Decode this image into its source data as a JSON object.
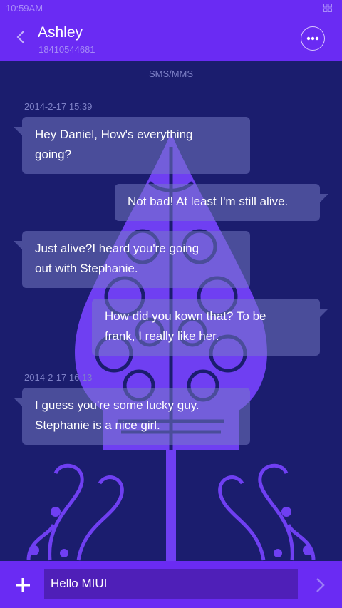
{
  "status_bar": {
    "time": "10:59AM"
  },
  "header": {
    "name": "Ashley",
    "number": "18410544681"
  },
  "thread": {
    "type_label": "SMS/MMS",
    "timestamps": [
      "2014-2-17 15:39",
      "2014-2-17 16:13"
    ],
    "messages": [
      {
        "direction": "in",
        "line1": "Hey Daniel, How's everything",
        "line2": "going?"
      },
      {
        "direction": "out",
        "line1": "Not bad! At least I'm still alive."
      },
      {
        "direction": "in",
        "line1": "Just  alive?I heard you're going",
        "line2": "out with Stephanie."
      },
      {
        "direction": "out",
        "line1": "How did you kown that? To be",
        "line2": "frank, I really like her."
      },
      {
        "direction": "in",
        "line1": "I guess you're some lucky guy.",
        "line2": "Stephanie is a nice girl."
      }
    ]
  },
  "composer": {
    "text": "Hello MIUI"
  },
  "colors": {
    "bar": "#6a2bf3",
    "background": "#1b1d6e",
    "bubble": "#767bc4",
    "art": "#6f3ff2"
  },
  "icons": [
    "back-arrow-icon",
    "more-icon",
    "plus-icon",
    "send-arrow-icon",
    "signal-icon"
  ]
}
